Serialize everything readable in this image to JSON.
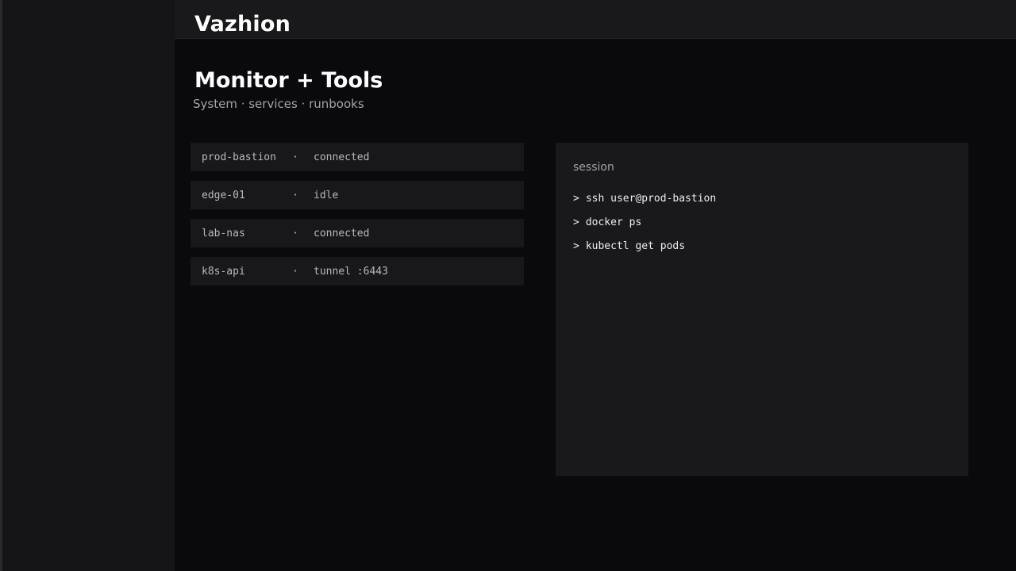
{
  "app": {
    "brand": "Vazhion"
  },
  "page": {
    "title": "Monitor + Tools",
    "subtitle": "System · services · runbooks"
  },
  "hosts": [
    {
      "name": "prod-bastion",
      "separator": "·",
      "status": "connected"
    },
    {
      "name": "edge-01",
      "separator": "·",
      "status": "idle"
    },
    {
      "name": "lab-nas",
      "separator": "·",
      "status": "connected"
    },
    {
      "name": "k8s-api",
      "separator": "·",
      "status": "tunnel :6443"
    }
  ],
  "session": {
    "title": "session",
    "prompt": ">",
    "commands": [
      "ssh user@prod-bastion",
      "docker ps",
      "kubectl get pods"
    ]
  },
  "colors": {
    "background": "#0a0a0c",
    "sidebar": "#151517",
    "topbar": "#19191b",
    "panel": "#19191b",
    "row": "#18181b",
    "muted_text": "#a3a3a8",
    "text": "#ffffff"
  }
}
